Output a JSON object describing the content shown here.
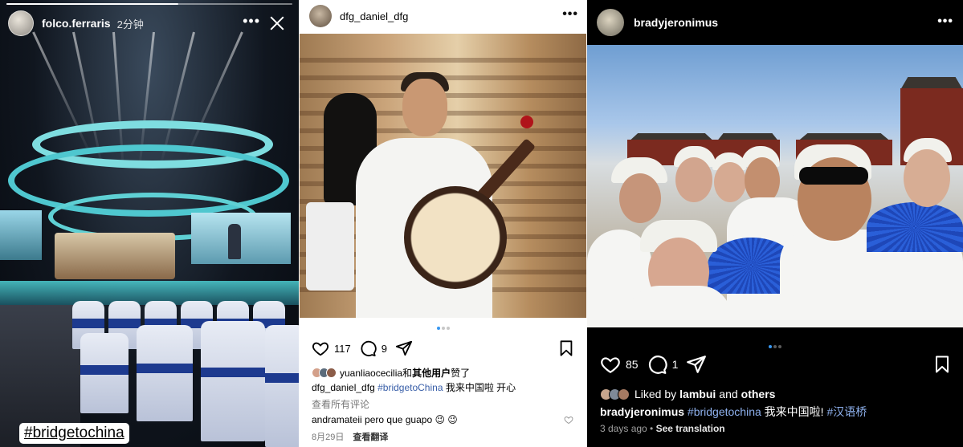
{
  "story": {
    "username": "folco.ferraris",
    "time_ago": "2分钟",
    "more_icon": "more-horizontal-icon",
    "close_icon": "close-icon",
    "sticker": "#bridgetochina",
    "progress_fraction": 0.6
  },
  "post_light": {
    "username": "dfg_daniel_dfg",
    "more_icon": "more-horizontal-icon",
    "carousel": {
      "count": 3,
      "active": 0
    },
    "likes": "117",
    "comments": "9",
    "liked_by_user": "yuanliaocecilia",
    "liked_by_join": "和",
    "liked_by_others": "其他用户",
    "liked_by_suffix": "赞了",
    "caption_user": "dfg_daniel_dfg",
    "caption_tag": "#bridgetoChina",
    "caption_text": " 我来中国啦 开心",
    "view_comments": "查看所有评论",
    "comment_user": "andramateii",
    "comment_text": " pero que guapo 😉 😉",
    "date": "8月29日",
    "translate": "查看翻译"
  },
  "post_dark": {
    "username": "bradyjeronimus",
    "more_icon": "more-horizontal-icon",
    "carousel": {
      "count": 3,
      "active": 0
    },
    "likes": "85",
    "comments": "1",
    "liked_by_prefix": "Liked by",
    "liked_by_user": "lambui",
    "liked_by_join": "and",
    "liked_by_others": "others",
    "caption_user": "bradyjeronimus",
    "caption_tag": "#bridgetochina",
    "caption_text": " 我来中国啦!",
    "caption_tag2": " #汉语桥",
    "time_ago": "3 days ago",
    "separator": " • ",
    "translate": "See translation"
  },
  "colors": {
    "accent_blue": "#3897f0",
    "hashtag_light": "#385ea8",
    "hashtag_dark": "#8fb2ef"
  }
}
